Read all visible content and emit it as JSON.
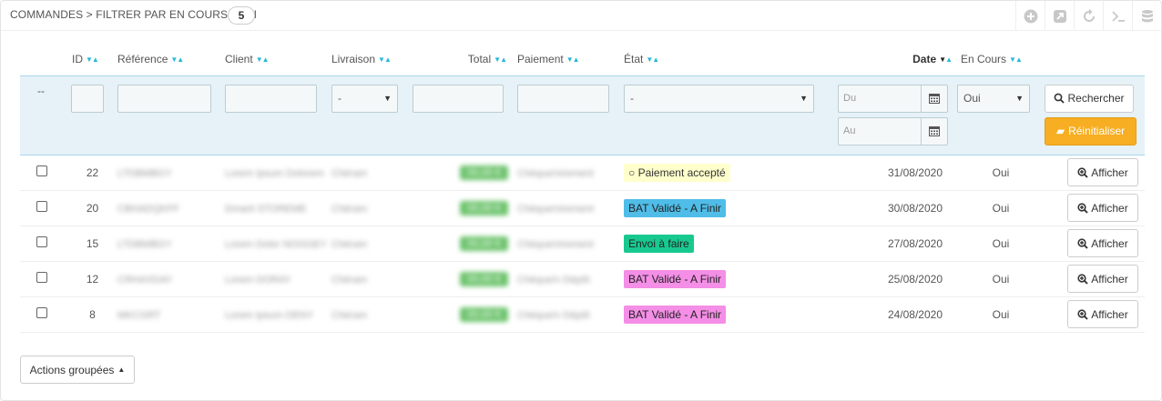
{
  "header": {
    "title": "Commandes > Filtrer par En cours : Oui",
    "count": "5"
  },
  "toolbar": {
    "icons": [
      "add-new-icon",
      "export-icon",
      "refresh-icon",
      "sql-query-icon",
      "sql-manager-icon"
    ]
  },
  "columns": {
    "id": "ID",
    "reference": "Référence",
    "client": "Client",
    "livraison": "Livraison",
    "total": "Total",
    "paiement": "Paiement",
    "etat": "État",
    "date": "Date",
    "en_cours": "En Cours"
  },
  "filters": {
    "dash": "--",
    "livraison_value": "-",
    "etat_value": "-",
    "date_from_placeholder": "Du",
    "date_to_placeholder": "Au",
    "en_cours_value": "Oui",
    "search_label": "Rechercher",
    "reset_label": "Réinitialiser"
  },
  "rows": [
    {
      "id": "22",
      "reference": "LTDBMBGY",
      "client": "Lorem Ipsum Dolorem",
      "livraison": "Chéram",
      "total": "00,00 €",
      "paiement": "Chèque/virement",
      "status": "○ Paiement accepté",
      "status_bg": "#ffffcc",
      "status_color": "#333333",
      "date": "31/08/2020",
      "en_cours": "Oui",
      "view_label": "Afficher"
    },
    {
      "id": "20",
      "reference": "CBHADQKFF",
      "client": "Dmarti STOREME",
      "livraison": "Chéram",
      "total": "00,00 €",
      "paiement": "Chèque/virement",
      "status": "BAT Validé - A Finir",
      "status_bg": "#4fbde8",
      "status_color": "#222222",
      "date": "30/08/2020",
      "en_cours": "Oui",
      "view_label": "Afficher"
    },
    {
      "id": "15",
      "reference": "LTDBMBGY",
      "client": "Lorem Dolor NOGGEY",
      "livraison": "Chéram",
      "total": "00,00 €",
      "paiement": "Chèque/virement",
      "status": "Envoi à faire",
      "status_bg": "#18c98f",
      "status_color": "#222222",
      "date": "27/08/2020",
      "en_cours": "Oui",
      "view_label": "Afficher"
    },
    {
      "id": "12",
      "reference": "CRHAXDAY",
      "client": "Lorem DORAY",
      "livraison": "Chéram",
      "total": "00,00 €",
      "paiement": "Chèque/v Dépôt",
      "status": "BAT Validé - A Finir",
      "status_bg": "#f48ee6",
      "status_color": "#222222",
      "date": "25/08/2020",
      "en_cours": "Oui",
      "view_label": "Afficher"
    },
    {
      "id": "8",
      "reference": "MKCGRT",
      "client": "Lorem ipsum DENY",
      "livraison": "Chéram",
      "total": "00,00 €",
      "paiement": "Chèque/v Dépôt",
      "status": "BAT Validé - A Finir",
      "status_bg": "#f48ee6",
      "status_color": "#222222",
      "date": "24/08/2020",
      "en_cours": "Oui",
      "view_label": "Afficher"
    }
  ],
  "footer": {
    "bulk_actions_label": "Actions groupées"
  }
}
